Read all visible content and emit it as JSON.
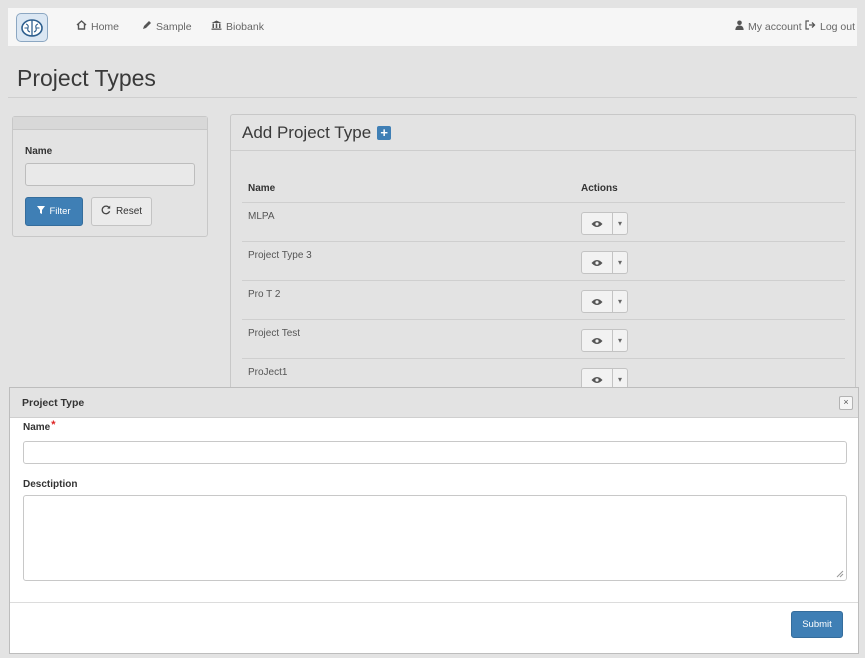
{
  "navbar": {
    "logo_icon": "brain-icon",
    "links": [
      {
        "label": "Home",
        "icon": "home-icon"
      },
      {
        "label": "Sample",
        "icon": "pencil-icon"
      },
      {
        "label": "Biobank",
        "icon": "bank-icon"
      }
    ],
    "right_links": [
      {
        "label": "My account",
        "icon": "user-icon"
      },
      {
        "label": "Log out",
        "icon": "logout-icon"
      }
    ]
  },
  "page": {
    "title": "Project Types"
  },
  "filter": {
    "name_label": "Name",
    "name_value": "",
    "filter_button": "Filter",
    "reset_button": "Reset"
  },
  "main": {
    "add_title": "Add Project Type",
    "columns": [
      "Name",
      "Actions"
    ],
    "rows": [
      {
        "name": "MLPA"
      },
      {
        "name": "Project Type 3"
      },
      {
        "name": "Pro T 2"
      },
      {
        "name": "Project Test"
      },
      {
        "name": "ProJect1"
      }
    ]
  },
  "modal": {
    "title": "Project Type",
    "close_label": "×",
    "name_label": "Name",
    "required_mark": "*",
    "name_value": "",
    "description_label": "Desctiption",
    "description_value": "",
    "submit_button": "Submit"
  },
  "colors": {
    "primary": "#3f7fb5",
    "background": "#e3e3e3",
    "navbar": "#f6f6f6",
    "required": "#dd2222"
  }
}
